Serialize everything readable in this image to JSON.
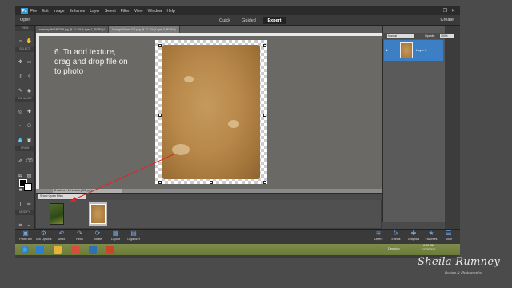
{
  "app": {
    "logo_text": "Ps",
    "menu": [
      "File",
      "Edit",
      "Image",
      "Enhance",
      "Layer",
      "Select",
      "Filter",
      "View",
      "Window",
      "Help"
    ],
    "window_controls": [
      "–",
      "❐",
      "✕"
    ]
  },
  "modebar": {
    "open_label": "Open",
    "tabs": [
      {
        "label": "Quick",
        "active": false
      },
      {
        "label": "Guided",
        "active": false
      },
      {
        "label": "Expert",
        "active": true
      }
    ],
    "create_label": "Create"
  },
  "toolbox": {
    "sections": [
      "VIEW",
      "SELECT",
      "ENHANCE",
      "DRAW",
      "MODIFY",
      "COLOR"
    ]
  },
  "document_tabs": [
    {
      "label": "scenery-IMGP3798.jpg @ 11.2% (Layer 1, RGB/8)*",
      "active": false
    },
    {
      "label": "Vintage-Paper-GP.png @ 71.3% (Layer 0, RGB/8)",
      "active": true
    }
  ],
  "canvas": {
    "instruction": "6. To add texture,\ndrag and drop file on\nto photo"
  },
  "status_bar": {
    "zoom": "11.2%",
    "doc_size": "8 inches x 10 inches (300 ppi)"
  },
  "photo_bin": {
    "show_label": "Show Open Files"
  },
  "layers_panel": {
    "blend_mode": "Normal",
    "opacity_label": "Opacity:",
    "opacity_value": "100%",
    "layer_name": "Layer 0"
  },
  "taskbar": {
    "left": [
      {
        "label": "Photo Bin",
        "icon": "photo-bin-icon",
        "glyph": "▣"
      },
      {
        "label": "Tool Options",
        "icon": "tool-options-icon",
        "glyph": "⚙"
      },
      {
        "label": "Undo",
        "icon": "undo-icon",
        "glyph": "↶"
      },
      {
        "label": "Redo",
        "icon": "redo-icon",
        "glyph": "↷"
      },
      {
        "label": "Rotate",
        "icon": "rotate-icon",
        "glyph": "⟳"
      },
      {
        "label": "Layout",
        "icon": "layout-icon",
        "glyph": "▦"
      },
      {
        "label": "Organizer",
        "icon": "organizer-icon",
        "glyph": "▤"
      }
    ],
    "right": [
      {
        "label": "Layers",
        "icon": "layers-icon",
        "glyph": "≋"
      },
      {
        "label": "Effects",
        "icon": "effects-icon",
        "glyph": "fx"
      },
      {
        "label": "Graphics",
        "icon": "graphics-icon",
        "glyph": "✚"
      },
      {
        "label": "Favorites",
        "icon": "favorites-icon",
        "glyph": "★"
      },
      {
        "label": "More",
        "icon": "more-icon",
        "glyph": "☰"
      }
    ]
  },
  "windows_taskbar": {
    "apps": [
      {
        "icon": "internet-explorer-icon",
        "color": "#2e7fd0"
      },
      {
        "icon": "file-explorer-icon",
        "color": "#e7b33a"
      },
      {
        "icon": "chrome-icon",
        "color": "#d94b3a"
      },
      {
        "icon": "photoshop-elements-icon",
        "color": "#2f6fb3"
      },
      {
        "icon": "powerpoint-icon",
        "color": "#c8442a"
      }
    ],
    "desktop_label": "Desktop",
    "time": "6:20 PM",
    "date": "1/22/2015"
  },
  "watermark": {
    "name": "Sheila Rumney",
    "subtitle": "Design & Photography"
  },
  "colors": {
    "accent": "#2f9bd8",
    "selected_layer": "#3d7fc4",
    "arrow": "#e02424"
  }
}
